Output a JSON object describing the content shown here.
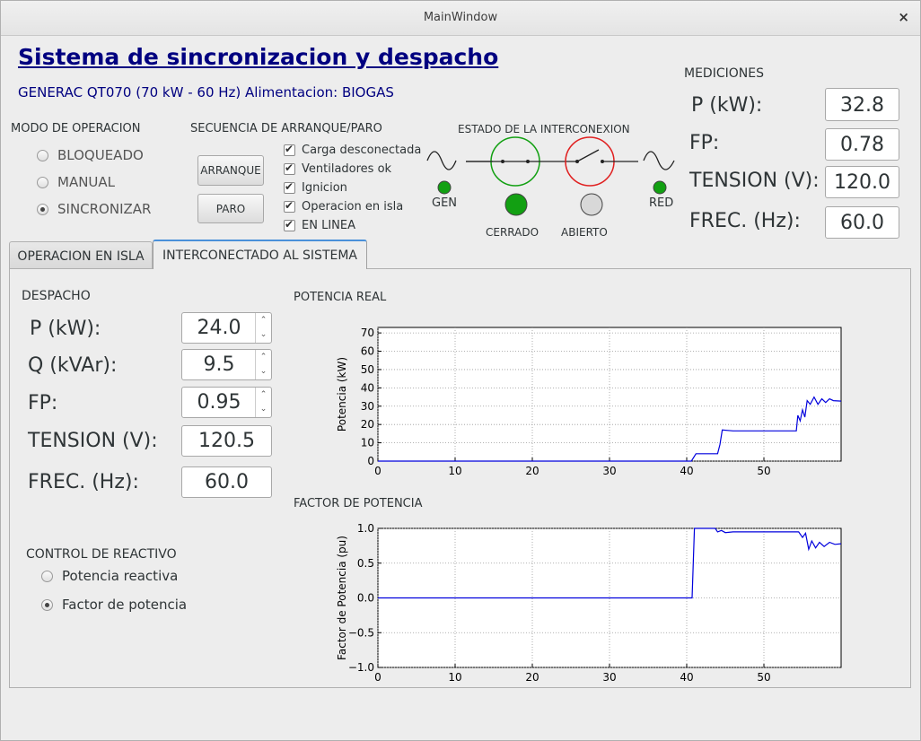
{
  "window": {
    "title": "MainWindow",
    "close_glyph": "×"
  },
  "header": {
    "title": "Sistema de sincronizacion y despacho",
    "subtitle": "GENERAC QT070 (70 kW - 60 Hz) Alimentacion: BIOGAS"
  },
  "modo": {
    "label": "MODO DE OPERACION",
    "options": [
      {
        "label": "BLOQUEADO",
        "selected": false
      },
      {
        "label": "MANUAL",
        "selected": false
      },
      {
        "label": "SINCRONIZAR",
        "selected": true
      }
    ]
  },
  "secuencia": {
    "label": "SECUENCIA DE ARRANQUE/PARO",
    "start_label": "ARRANQUE",
    "stop_label": "PARO",
    "checks": [
      {
        "label": "Carga desconectada",
        "checked": true
      },
      {
        "label": "Ventiladores ok",
        "checked": true
      },
      {
        "label": "Ignicion",
        "checked": true
      },
      {
        "label": "Operacion en isla",
        "checked": true
      },
      {
        "label": "EN LINEA",
        "checked": true
      }
    ]
  },
  "interconexion": {
    "label": "ESTADO DE LA INTERCONEXION",
    "gen_label": "GEN",
    "red_label": "RED",
    "cerrado_label": "CERRADO",
    "abierto_label": "ABIERTO",
    "colors": {
      "green": "#12a012",
      "red": "#e02020",
      "grey": "#d8d8d8"
    }
  },
  "mediciones": {
    "label": "MEDICIONES",
    "rows": [
      {
        "label": "P (kW):",
        "value": "32.8"
      },
      {
        "label": "FP:",
        "value": "0.78"
      },
      {
        "label": "TENSION (V):",
        "value": "120.0"
      },
      {
        "label": "FREC. (Hz):",
        "value": "60.0"
      }
    ]
  },
  "tabs": [
    {
      "label": "OPERACION EN ISLA",
      "active": false
    },
    {
      "label": "INTERCONECTADO AL SISTEMA",
      "active": true
    }
  ],
  "despacho": {
    "label": "DESPACHO",
    "p_label": "P (kW):",
    "p_value": "24.0",
    "q_label": "Q (kVAr):",
    "q_value": "9.5",
    "fp_label": "FP:",
    "fp_value": "0.95",
    "v_label": "TENSION (V):",
    "v_value": "120.5",
    "f_label": "FREC. (Hz):",
    "f_value": "60.0",
    "up_glyph": "⌃",
    "down_glyph": "⌄"
  },
  "reactivo": {
    "label": "CONTROL DE REACTIVO",
    "options": [
      {
        "label": "Potencia reactiva",
        "selected": false
      },
      {
        "label": "Factor de potencia",
        "selected": true
      }
    ]
  },
  "chart_data": [
    {
      "type": "line",
      "title": "POTENCIA REAL",
      "ylabel": "Potencia (kW)",
      "xlim": [
        0,
        60
      ],
      "ylim": [
        0,
        73
      ],
      "xticks": [
        0,
        10,
        20,
        30,
        40,
        50
      ],
      "yticks": [
        0,
        10,
        20,
        30,
        40,
        50,
        60,
        70
      ],
      "grid": true,
      "color": "#0000dd",
      "points": [
        [
          0,
          0
        ],
        [
          40.6,
          0
        ],
        [
          41.2,
          4
        ],
        [
          44,
          4
        ],
        [
          44.3,
          9
        ],
        [
          44.6,
          17
        ],
        [
          46,
          16.5
        ],
        [
          54.2,
          16.5
        ],
        [
          54.4,
          25
        ],
        [
          54.7,
          22
        ],
        [
          55,
          28
        ],
        [
          55.3,
          24
        ],
        [
          55.6,
          33
        ],
        [
          56,
          31
        ],
        [
          56.5,
          35
        ],
        [
          57,
          31
        ],
        [
          57.5,
          34
        ],
        [
          58,
          32
        ],
        [
          58.5,
          34
        ],
        [
          59,
          33
        ],
        [
          60,
          32.8
        ]
      ]
    },
    {
      "type": "line",
      "title": "FACTOR DE POTENCIA",
      "ylabel": "Factor de Potencia (pu)",
      "xlim": [
        0,
        60
      ],
      "ylim": [
        -1.0,
        1.0
      ],
      "xticks": [
        0,
        10,
        20,
        30,
        40,
        50
      ],
      "yticks": [
        "1.0",
        "0.5",
        "0.0",
        "−0.5",
        "−1.0"
      ],
      "grid": true,
      "color": "#0000dd",
      "points": [
        [
          0,
          0
        ],
        [
          40.7,
          0
        ],
        [
          41,
          1.0
        ],
        [
          43.7,
          1.0
        ],
        [
          44,
          0.95
        ],
        [
          44.5,
          0.97
        ],
        [
          45,
          0.94
        ],
        [
          46,
          0.95
        ],
        [
          54.5,
          0.95
        ],
        [
          55,
          0.87
        ],
        [
          55.4,
          0.93
        ],
        [
          55.8,
          0.7
        ],
        [
          56.2,
          0.82
        ],
        [
          56.7,
          0.72
        ],
        [
          57.2,
          0.8
        ],
        [
          57.8,
          0.74
        ],
        [
          58.5,
          0.8
        ],
        [
          59.2,
          0.77
        ],
        [
          60,
          0.78
        ]
      ]
    }
  ]
}
